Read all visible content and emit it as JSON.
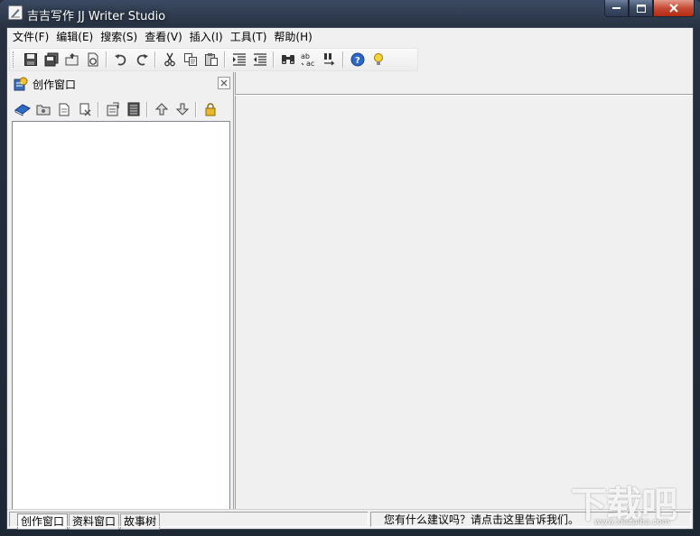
{
  "window": {
    "title": "吉吉写作 JJ Writer Studio",
    "caption_buttons": [
      "minimize-icon",
      "maximize-icon",
      "close-icon"
    ]
  },
  "menu": {
    "items": [
      {
        "label": "文件(F)"
      },
      {
        "label": "编辑(E)"
      },
      {
        "label": "搜索(S)"
      },
      {
        "label": "查看(V)"
      },
      {
        "label": "插入(I)"
      },
      {
        "label": "工具(T)"
      },
      {
        "label": "帮助(H)"
      }
    ]
  },
  "toolbar": {
    "buttons": [
      "save-icon",
      "save-all-icon",
      "open-icon",
      "close-file-icon",
      "undo-icon",
      "redo-icon",
      "cut-icon",
      "copy-icon",
      "paste-icon",
      "indent-icon",
      "outdent-icon",
      "find-icon",
      "spell-check-icon",
      "replace-icon",
      "help-icon",
      "tip-icon"
    ]
  },
  "left_panel": {
    "title": "创作窗口",
    "toolbar_buttons": [
      "book-icon",
      "folder-icon",
      "new-document-icon",
      "delete-document-icon",
      "properties-icon",
      "notes-icon",
      "move-up-icon",
      "move-down-icon",
      "lock-icon"
    ],
    "tabs": [
      {
        "label": "创作窗口"
      },
      {
        "label": "资料窗口"
      },
      {
        "label": "故事树"
      }
    ]
  },
  "statusbar": {
    "message": "您有什么建议吗？请点击这里告诉我们。"
  },
  "watermark": {
    "main": "下载吧",
    "sub": "www.xiazaiba.com"
  },
  "colors": {
    "titlebar": "#26303f",
    "client": "#f0f0f0",
    "close_button": "#c44c35"
  }
}
